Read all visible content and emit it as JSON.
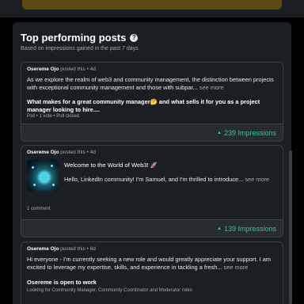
{
  "section": {
    "title": "Top performing posts",
    "subtitle": "Based on impressions gained in the past 7 days"
  },
  "posts": [
    {
      "author": "Osereme Ojo",
      "posted_suffix": " posted this • 4d",
      "text": "As we explore the realm of web3 and community management, the distinction between projects with exceptional community management and those with subpar...",
      "more": "see more",
      "bold_text": "What makes for a great community manager🤔 and what sells it for you as a project manager looking to hire....",
      "meta": "Poll • 1 vote • Poll closed",
      "impressions": "239 Impressions"
    },
    {
      "author": "Osereme Ojo",
      "posted_suffix": " posted this • 4d",
      "article_title": "Welcome to the World of Web3! 🚀",
      "article_desc": "Hello, LinkedIn community! I'm Samuel, and I'm thrilled to introduce...",
      "more": "see more",
      "comments": "1 comment",
      "impressions": "139 Impressions"
    },
    {
      "author": "Osereme Ojo",
      "posted_suffix": " posted this • 6d",
      "text": "Hi everyone - I'm currently seeking a new role and would greatly appreciate your support. I am excited to leverage my expertise, skills, and experience in tackling a fresh...",
      "more": "see more",
      "bold_text": "Osereme is open to work",
      "meta": "Looking for Community Manager, Community Coordinator and Moderator roles"
    }
  ],
  "colors": {
    "impressions": "#3fbf9f",
    "panel": "#1b1f23",
    "top_bar": "#5c4a10"
  }
}
